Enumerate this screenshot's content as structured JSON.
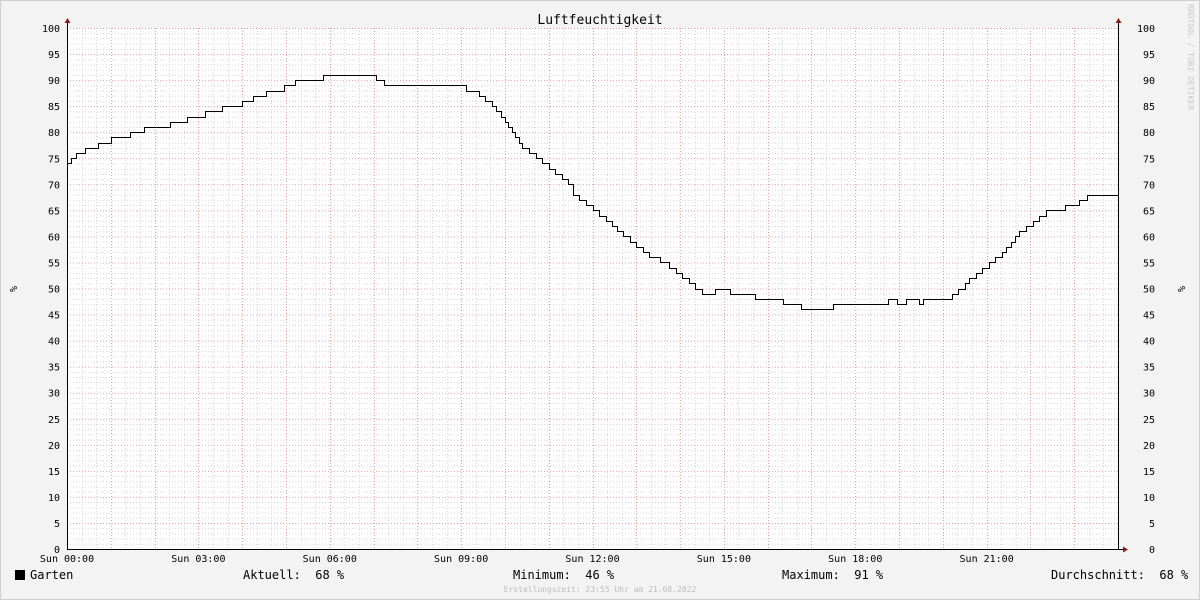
{
  "chart_data": {
    "type": "line",
    "title": "Luftfeuchtigkeit",
    "ylabel": "%",
    "ylim": [
      0,
      100
    ],
    "y_ticks": [
      0,
      5,
      10,
      15,
      20,
      25,
      30,
      35,
      40,
      45,
      50,
      55,
      60,
      65,
      70,
      75,
      80,
      85,
      90,
      95,
      100
    ],
    "x_ticks": [
      {
        "label": "Sun 00:00",
        "hour": 0
      },
      {
        "label": "Sun 03:00",
        "hour": 3
      },
      {
        "label": "Sun 06:00",
        "hour": 6
      },
      {
        "label": "Sun 09:00",
        "hour": 9
      },
      {
        "label": "Sun 12:00",
        "hour": 12
      },
      {
        "label": "Sun 15:00",
        "hour": 15
      },
      {
        "label": "Sun 18:00",
        "hour": 18
      },
      {
        "label": "Sun 21:00",
        "hour": 21
      }
    ],
    "xlim": [
      0,
      24
    ],
    "grid": true,
    "series": [
      {
        "name": "Garten",
        "color": "#000000",
        "hours": [
          0.0,
          0.1,
          0.2,
          0.4,
          0.7,
          1.0,
          1.45,
          1.75,
          2.35,
          2.75,
          3.15,
          3.55,
          4.0,
          4.25,
          4.55,
          4.95,
          5.2,
          5.85,
          6.4,
          7.05,
          7.25,
          8.7,
          9.1,
          9.4,
          9.55,
          9.7,
          9.8,
          9.9,
          10.0,
          10.08,
          10.16,
          10.24,
          10.32,
          10.4,
          10.55,
          10.7,
          10.85,
          11.0,
          11.15,
          11.3,
          11.45,
          11.55,
          11.7,
          11.85,
          12.0,
          12.15,
          12.3,
          12.45,
          12.55,
          12.7,
          12.85,
          13.0,
          13.15,
          13.3,
          13.55,
          13.75,
          13.9,
          14.05,
          14.2,
          14.35,
          14.5,
          14.8,
          15.15,
          15.7,
          16.35,
          16.55,
          16.75,
          17.5,
          17.75,
          18.0,
          18.75,
          18.95,
          19.15,
          19.45,
          19.55,
          19.65,
          19.75,
          20.05,
          20.2,
          20.35,
          20.5,
          20.6,
          20.75,
          20.9,
          21.05,
          21.2,
          21.35,
          21.45,
          21.55,
          21.65,
          21.75,
          21.9,
          22.05,
          22.2,
          22.35,
          22.6,
          22.8,
          23.1,
          23.3,
          23.55,
          23.75,
          24.0
        ],
        "values": [
          74,
          75,
          76,
          77,
          78,
          79,
          80,
          81,
          82,
          83,
          84,
          85,
          86,
          87,
          88,
          89,
          90,
          91,
          91,
          90,
          89,
          89,
          88,
          87,
          86,
          85,
          84,
          83,
          82,
          81,
          80,
          79,
          78,
          77,
          76,
          75,
          74,
          73,
          72,
          71,
          70,
          68,
          67,
          66,
          65,
          64,
          63,
          62,
          61,
          60,
          59,
          58,
          57,
          56,
          55,
          54,
          53,
          52,
          51,
          50,
          49,
          50,
          49,
          48,
          47,
          47,
          46,
          47,
          47,
          47,
          48,
          47,
          48,
          47,
          48,
          48,
          48,
          48,
          49,
          50,
          51,
          52,
          53,
          54,
          55,
          56,
          57,
          58,
          59,
          60,
          61,
          62,
          63,
          64,
          65,
          65,
          66,
          67,
          68,
          68,
          68,
          68
        ]
      }
    ]
  },
  "legend": {
    "series_name": "Garten",
    "current_label": "Aktuell:",
    "current_value": "68 %",
    "min_label": "Minimum:",
    "min_value": "46 %",
    "max_label": "Maximum:",
    "max_value": "91 %",
    "avg_label": "Durchschnitt:",
    "avg_value": "68 %"
  },
  "footer": "Erstellungszeit: 23:55 Uhr am 21.08.2022",
  "watermark": "RRDTOOL / TOBI OETIKER"
}
